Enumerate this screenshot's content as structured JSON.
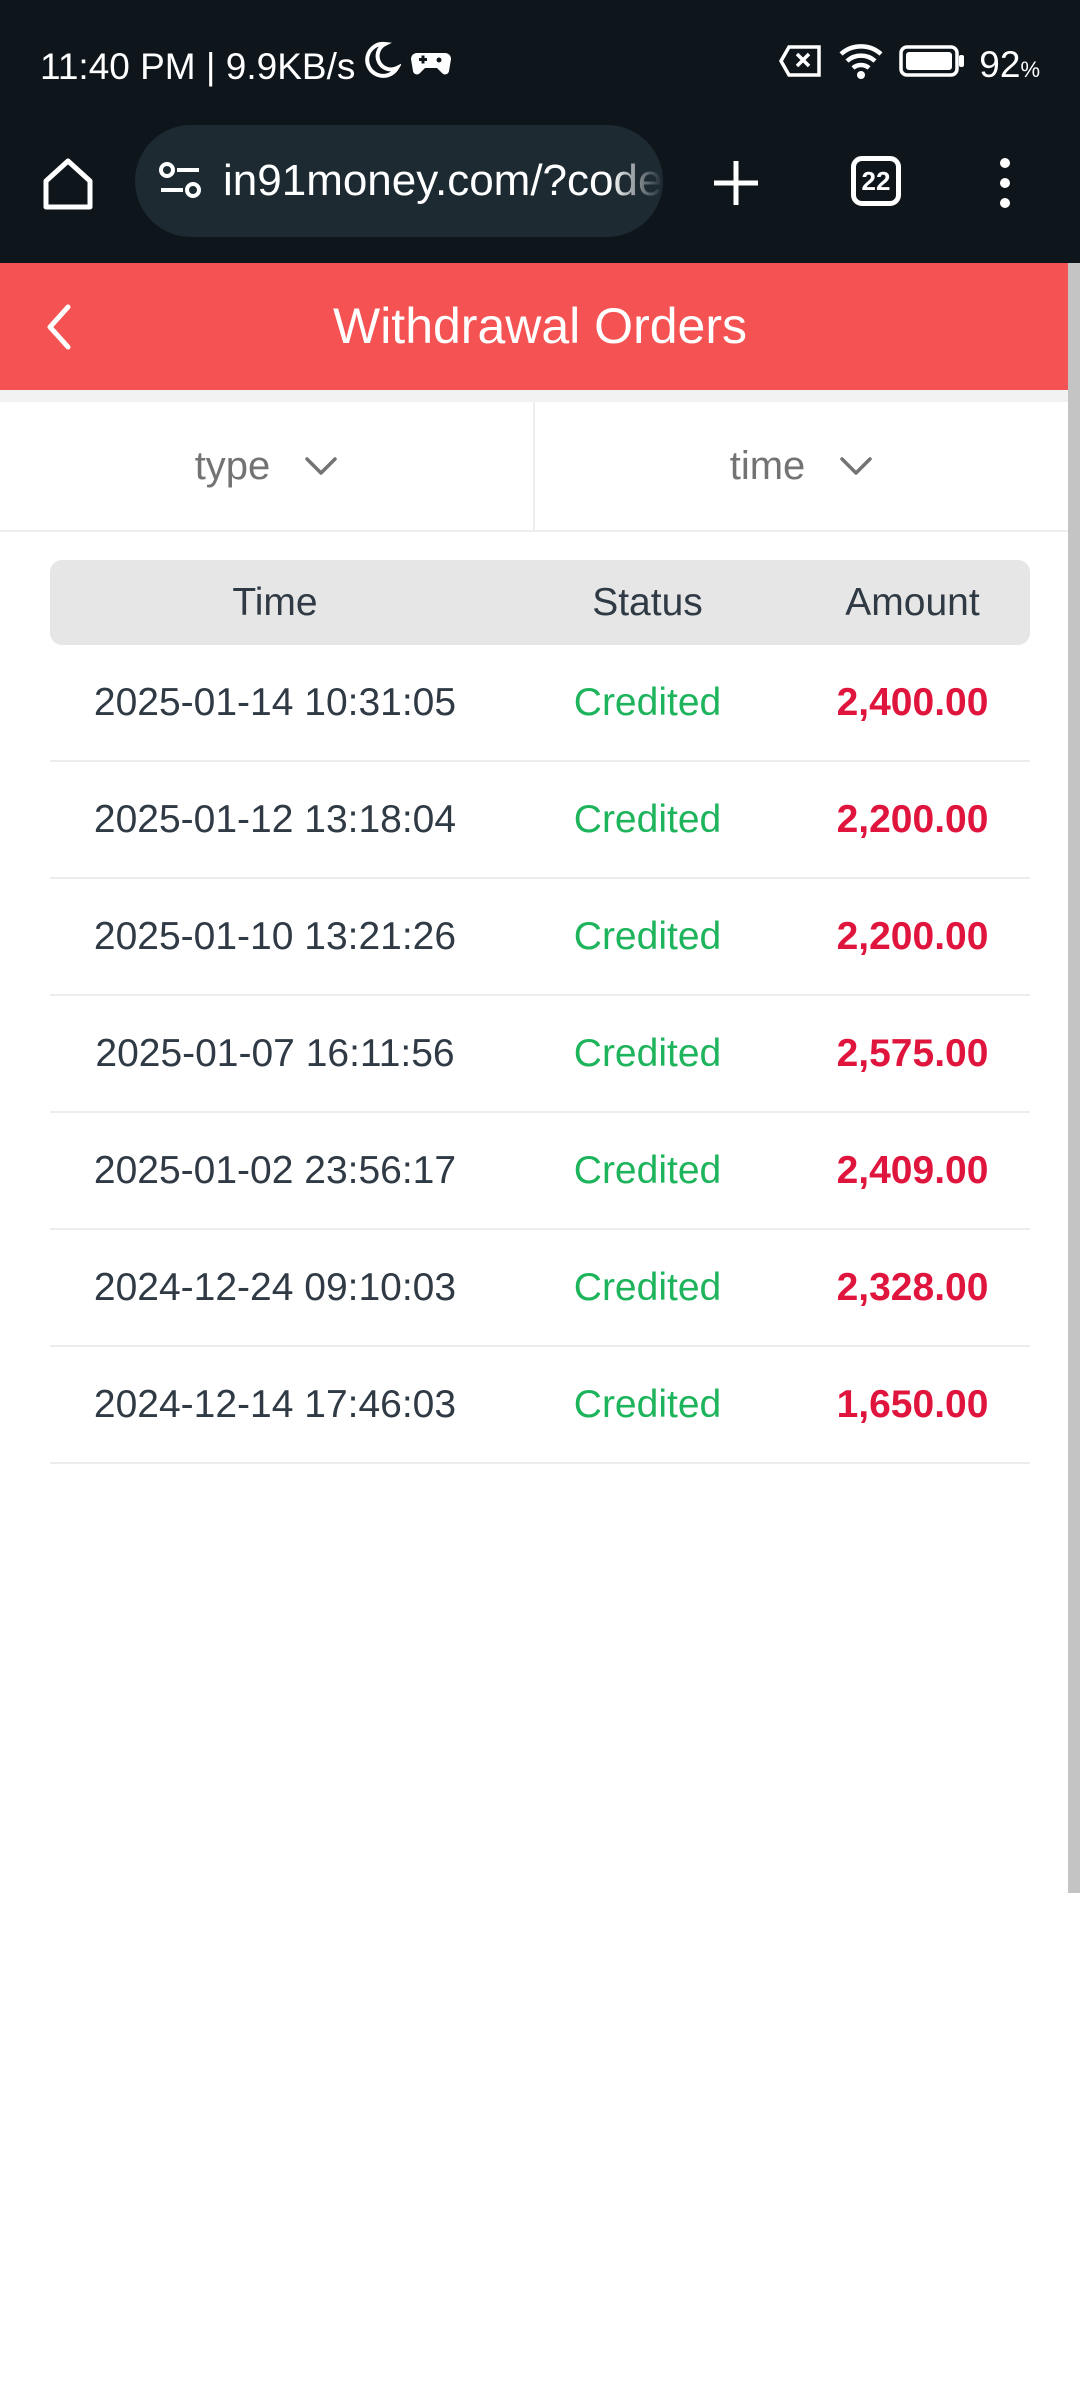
{
  "status_bar": {
    "time_speed": "11:40 PM | 9.9KB/s",
    "battery_percent": "92",
    "battery_unit": "%",
    "icons": [
      "moon-icon",
      "gamepad-icon",
      "sim-off-icon",
      "wifi-icon",
      "battery-icon"
    ]
  },
  "browser": {
    "url": "in91money.com/?code",
    "tab_count": "22",
    "icons": [
      "home-icon",
      "site-settings-icon",
      "plus-icon",
      "tabs-icon",
      "more-vert-icon"
    ]
  },
  "header": {
    "title": "Withdrawal Orders",
    "back_icon": "chevron-left-icon",
    "color": "#f55353"
  },
  "filters": {
    "type_label": "type",
    "time_label": "time"
  },
  "table": {
    "headers": {
      "time": "Time",
      "status": "Status",
      "amount": "Amount"
    },
    "rows": [
      {
        "time": "2025-01-14 10:31:05",
        "status": "Credited",
        "amount": "2,400.00"
      },
      {
        "time": "2025-01-12 13:18:04",
        "status": "Credited",
        "amount": "2,200.00"
      },
      {
        "time": "2025-01-10 13:21:26",
        "status": "Credited",
        "amount": "2,200.00"
      },
      {
        "time": "2025-01-07 16:11:56",
        "status": "Credited",
        "amount": "2,575.00"
      },
      {
        "time": "2025-01-02 23:56:17",
        "status": "Credited",
        "amount": "2,409.00"
      },
      {
        "time": "2024-12-24 09:10:03",
        "status": "Credited",
        "amount": "2,328.00"
      },
      {
        "time": "2024-12-14 17:46:03",
        "status": "Credited",
        "amount": "1,650.00"
      }
    ],
    "status_color": "#1db45c",
    "amount_color": "#e0153d"
  }
}
